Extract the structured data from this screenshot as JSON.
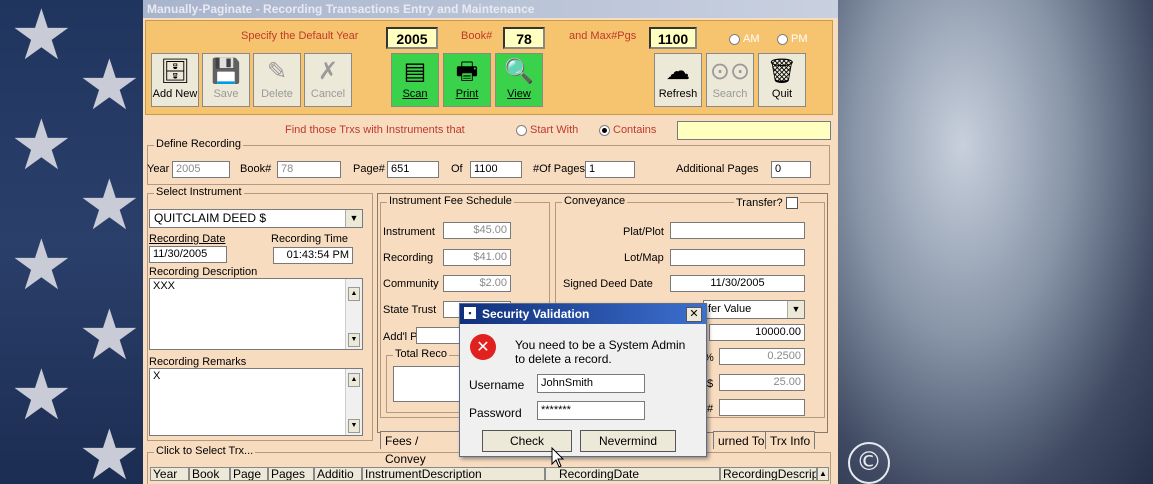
{
  "window_title": "Manually-Paginate - Recording Transactions Entry and Maintenance",
  "header": {
    "default_year_label": "Specify the Default Year",
    "default_year": "2005",
    "book_label": "Book#",
    "book": "78",
    "max_pgs_label": "and Max#Pgs",
    "max_pgs": "1100",
    "am_label": "AM",
    "pm_label": "PM"
  },
  "toolbar": {
    "add_new": "Add New",
    "save": "Save",
    "delete": "Delete",
    "cancel": "Cancel",
    "scan": "Scan",
    "print": "Print",
    "view": "View",
    "refresh": "Refresh",
    "search": "Search",
    "quit": "Quit"
  },
  "find": {
    "label": "Find those Trxs with Instruments that",
    "start_with": "Start With",
    "contains": "Contains",
    "value": ""
  },
  "define_recording": {
    "title": "Define Recording",
    "year_label": "Year",
    "year": "2005",
    "book_label": "Book#",
    "book": "78",
    "page_label": "Page#",
    "page": "651",
    "of_label": "Of",
    "of": "1100",
    "num_pages_label": "#Of Pages",
    "num_pages": "1",
    "additional_label": "Additional Pages",
    "additional": "0"
  },
  "select_instrument": {
    "title": "Select Instrument",
    "instrument": "QUITCLAIM DEED $",
    "recording_date_label": "Recording Date",
    "recording_date": "11/30/2005",
    "recording_time_label": "Recording Time",
    "recording_time": "01:43:54 PM",
    "description_label": "Recording Description",
    "description": "XXX",
    "remarks_label": "Recording Remarks",
    "remarks": "X"
  },
  "fee_schedule": {
    "title": "Instrument Fee Schedule",
    "instrument_label": "Instrument",
    "instrument": "$45.00",
    "recording_label": "Recording",
    "recording": "$41.00",
    "community_label": "Community",
    "community": "$2.00",
    "state_trust_label": "State Trust",
    "addl_page_label": "Add'l Page",
    "total_label": "Total Reco"
  },
  "conveyance": {
    "title": "Conveyance",
    "transfer_label": "Transfer?",
    "plat_label": "Plat/Plot",
    "lot_label": "Lot/Map",
    "signed_label": "Signed Deed Date",
    "signed": "11/30/2005",
    "value_type": "fer Value",
    "value": "10000.00",
    "rate_suffix": "%",
    "rate": "0.2500",
    "amount_prefix": "$",
    "amount": "25.00",
    "hash_suffix": "#"
  },
  "tabs": {
    "fees": "Fees / Convey",
    "returned": "urned To",
    "trx_info": "Trx Info"
  },
  "grid": {
    "title": "Click to Select Trx...",
    "columns": [
      "Year",
      "Book",
      "Page",
      "Pages",
      "Additio",
      "InstrumentDescription",
      "RecordingDate",
      "RecordingDescrip"
    ]
  },
  "dialog": {
    "title": "Security Validation",
    "message_line1": "You need to be a System Admin",
    "message_line2": "to delete a record.",
    "username_label": "Username",
    "username": "JohnSmith",
    "password_label": "Password",
    "password": "*******",
    "check": "Check",
    "nevermind": "Nevermind"
  },
  "watermark": "©",
  "colors": {
    "toolbar_bg": "#f6c46f",
    "form_bg": "#f7dcc0",
    "green_button": "#3ad24a",
    "highlight_field": "#ffffc0"
  }
}
